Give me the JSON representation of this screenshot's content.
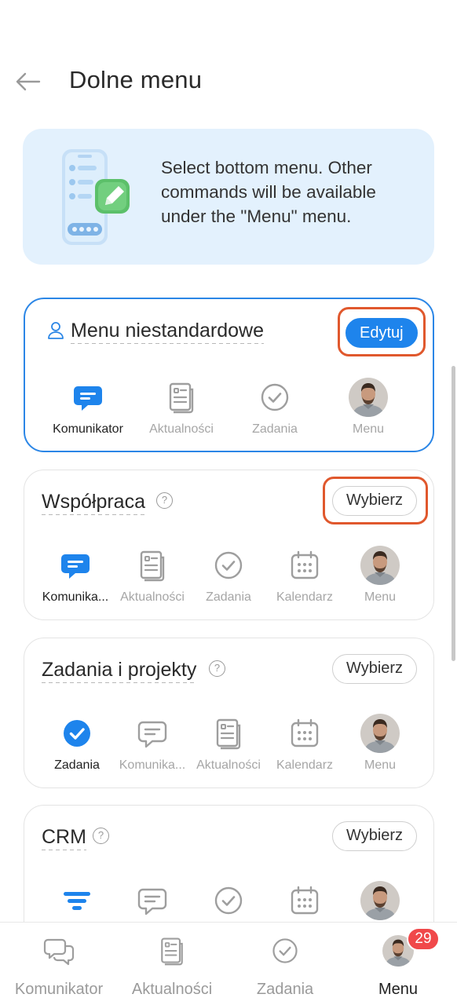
{
  "header": {
    "title": "Dolne menu"
  },
  "banner": {
    "text": "Select bottom menu. Other commands will be available under the \"Menu\" menu."
  },
  "cards": [
    {
      "title": "Menu niestandardowe",
      "button": "Edytuj",
      "items": [
        "Komunikator",
        "Aktualności",
        "Zadania",
        "Menu"
      ]
    },
    {
      "title": "Współpraca",
      "button": "Wybierz",
      "items": [
        "Komunika...",
        "Aktualności",
        "Zadania",
        "Kalendarz",
        "Menu"
      ]
    },
    {
      "title": "Zadania i projekty",
      "button": "Wybierz",
      "items": [
        "Zadania",
        "Komunika...",
        "Aktualności",
        "Kalendarz",
        "Menu"
      ]
    },
    {
      "title": "CRM",
      "button": "Wybierz"
    }
  ],
  "bottom_nav": {
    "items": [
      "Komunikator",
      "Aktualności",
      "Zadania",
      "Menu"
    ],
    "badge": "29"
  },
  "colors": {
    "accent": "#1e84ec",
    "highlight": "#e0582d",
    "badge": "#f0484a"
  }
}
